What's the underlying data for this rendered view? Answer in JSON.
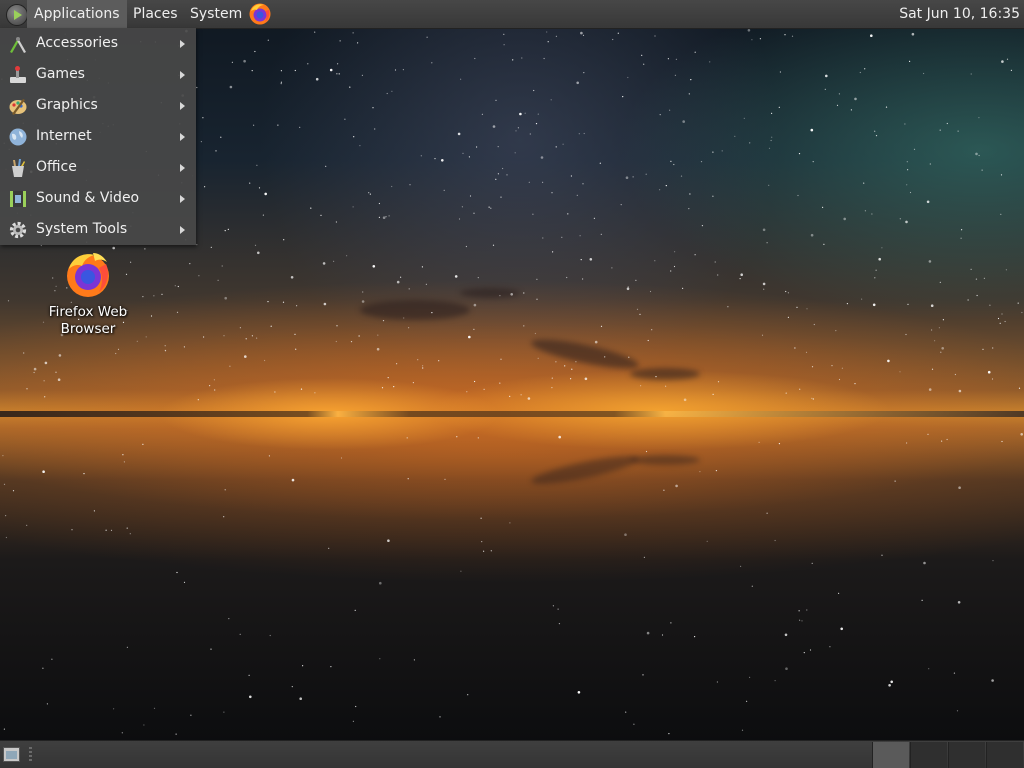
{
  "top_panel": {
    "menus": [
      "Applications",
      "Places",
      "System"
    ],
    "launcher_icon": "firefox-icon",
    "clock": "Sat Jun 10, 16:35"
  },
  "applications_menu": {
    "items": [
      {
        "label": "Accessories",
        "icon": "accessories-icon"
      },
      {
        "label": "Games",
        "icon": "games-icon"
      },
      {
        "label": "Graphics",
        "icon": "graphics-icon"
      },
      {
        "label": "Internet",
        "icon": "internet-icon"
      },
      {
        "label": "Office",
        "icon": "office-icon"
      },
      {
        "label": "Sound & Video",
        "icon": "sound-video-icon"
      },
      {
        "label": "System Tools",
        "icon": "system-tools-icon"
      }
    ]
  },
  "desktop": {
    "icons": [
      {
        "label": "Firefox Web Browser",
        "icon": "firefox-icon"
      }
    ]
  },
  "bottom_panel": {
    "show_desktop_icon": "show-desktop-icon",
    "workspace_count": 4,
    "current_workspace": 1
  },
  "colors": {
    "panel_bg": "#3c3c3c",
    "menu_bg": "#484848",
    "menu_text": "#f0f0f0",
    "accent_green": "#9ad05a"
  }
}
